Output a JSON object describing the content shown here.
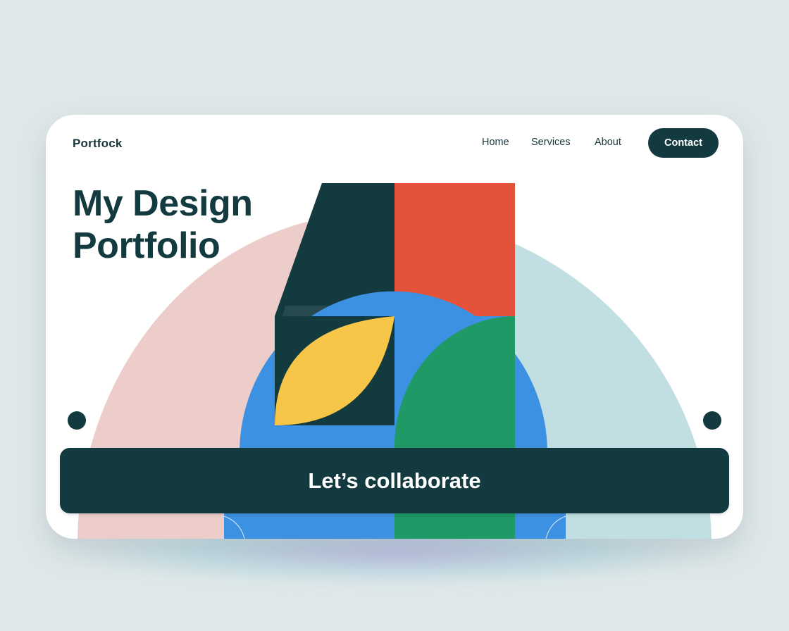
{
  "header": {
    "brand": "Portfock",
    "nav": [
      {
        "label": "Home"
      },
      {
        "label": "Services"
      },
      {
        "label": "About"
      }
    ],
    "contact_label": "Contact"
  },
  "hero": {
    "title_line1": "My Design",
    "title_line2": "Portfolio",
    "cta_label": "Let’s collaborate"
  },
  "colors": {
    "page_background": "#dfe8e9",
    "card_background": "#ffffff",
    "primary_dark": "#123a3f",
    "accent_red": "#e5523a",
    "accent_blue": "#3d91e2",
    "accent_green": "#1f9a66",
    "accent_yellow": "#f7c548",
    "pastel_pink": "#edcdca",
    "pastel_blue": "#c1dfe3"
  }
}
